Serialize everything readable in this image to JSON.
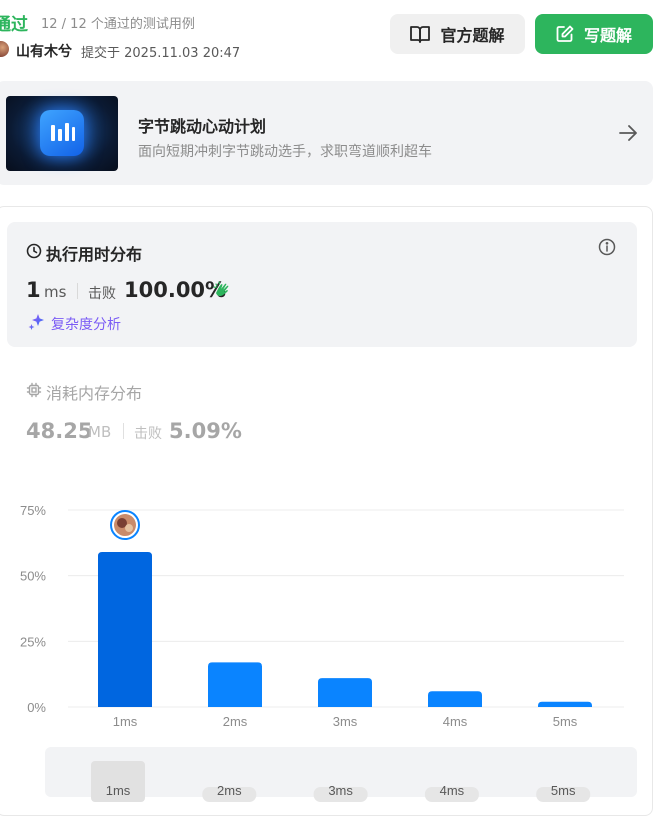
{
  "header": {
    "status": "通过",
    "testcases": "12 / 12 个通过的测试用例",
    "username": "山有木兮",
    "submitted_at": "提交于 2025.11.03 20:47",
    "official_solution_label": "官方题解",
    "write_solution_label": "写题解"
  },
  "banner": {
    "title": "字节跳动心动计划",
    "subtitle": "面向短期冲刺字节跳动选手，求职弯道顺利超车"
  },
  "runtime": {
    "title": "执行用时分布",
    "value": "1",
    "unit": "ms",
    "beats_label": "击败",
    "beats_value": "100.00%",
    "complexity_label": "复杂度分析"
  },
  "memory": {
    "title": "消耗内存分布",
    "value": "48.25",
    "unit": "MB",
    "beats_label": "击败",
    "beats_value": "5.09%"
  },
  "colors": {
    "accent_green": "#2db55d",
    "bar_blue": "#0a84ff",
    "bar_selected": "#0066e0",
    "purple": "#7b5cf5"
  },
  "chart_data": {
    "type": "bar",
    "categories": [
      "1ms",
      "2ms",
      "3ms",
      "4ms",
      "5ms"
    ],
    "values": [
      59,
      17,
      11,
      6,
      2
    ],
    "ylim": [
      0,
      75
    ],
    "yticks": [
      "0%",
      "25%",
      "50%",
      "75%"
    ],
    "selected": "1ms",
    "grid": true
  },
  "scrubber": {
    "labels": [
      "1ms",
      "2ms",
      "3ms",
      "4ms",
      "5ms"
    ]
  }
}
